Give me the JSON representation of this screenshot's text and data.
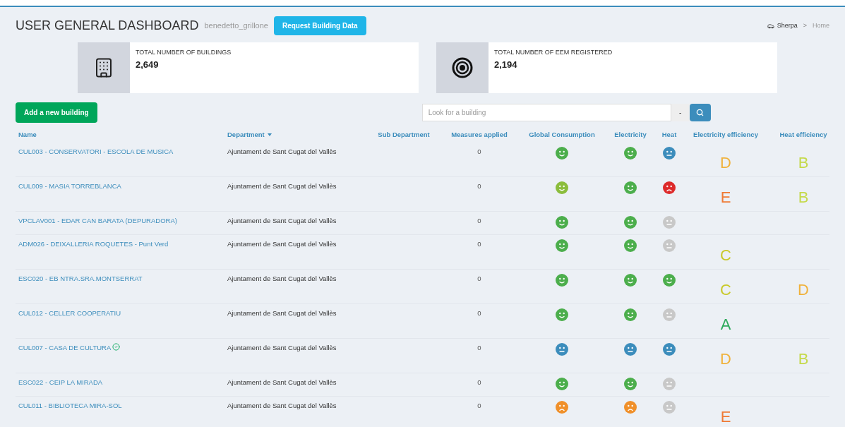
{
  "header": {
    "title": "USER GENERAL DASHBOARD",
    "username": "benedetto_grillone",
    "request_button": "Request Building Data"
  },
  "breadcrumb": {
    "items": [
      "Sherpa",
      "Home"
    ],
    "separator": ">"
  },
  "stats": [
    {
      "kind": "building",
      "label": "TOTAL NUMBER OF BUILDINGS",
      "value": "2,649"
    },
    {
      "kind": "target",
      "label": "TOTAL NUMBER OF EEM REGISTERED",
      "value": "2,194"
    }
  ],
  "add_button": "Add a new building",
  "search": {
    "placeholder": "Look for a building",
    "dropdown": "-"
  },
  "table": {
    "columns": [
      {
        "label": "Name",
        "sorted": false
      },
      {
        "label": "Department",
        "sorted": true
      },
      {
        "label": "Sub Department",
        "sorted": false
      },
      {
        "label": "Measures applied",
        "sorted": false
      },
      {
        "label": "Global Consumption",
        "sorted": false
      },
      {
        "label": "Electricity",
        "sorted": false
      },
      {
        "label": "Heat",
        "sorted": false
      },
      {
        "label": "Electricity efficiency",
        "sorted": false
      },
      {
        "label": "Heat efficiency",
        "sorted": false
      }
    ],
    "rows": [
      {
        "name": "CUL003 - CONSERVATORI - ESCOLA DE MUSICA",
        "verified": false,
        "department": "Ajuntament de Sant Cugat del Vallès",
        "measures": "0",
        "global": {
          "kind": "happy",
          "color": "#4cae4c"
        },
        "electricity": {
          "kind": "happy",
          "color": "#4cae4c"
        },
        "heat": {
          "kind": "neutral",
          "color": "#3c8dbc"
        },
        "elec_eff": {
          "grade": "D",
          "color": "#f0b23c"
        },
        "heat_eff": {
          "grade": "B",
          "color": "#c5d94a"
        }
      },
      {
        "name": "CUL009 - MASIA TORREBLANCA",
        "verified": false,
        "department": "Ajuntament de Sant Cugat del Vallès",
        "measures": "0",
        "global": {
          "kind": "happy",
          "color": "#8bbd3c"
        },
        "electricity": {
          "kind": "happy",
          "color": "#4cae4c"
        },
        "heat": {
          "kind": "sad",
          "color": "#dd2a2a"
        },
        "elec_eff": {
          "grade": "E",
          "color": "#ef7a35"
        },
        "heat_eff": {
          "grade": "B",
          "color": "#c5d94a"
        }
      },
      {
        "name": "VPCLAV001 - EDAR CAN BARATA (DEPURADORA)",
        "verified": false,
        "department": "Ajuntament de Sant Cugat del Vallès",
        "measures": "0",
        "global": {
          "kind": "happy",
          "color": "#4cae4c"
        },
        "electricity": {
          "kind": "happy",
          "color": "#4cae4c"
        },
        "heat": {
          "kind": "neutral",
          "color": "#c8c8c8"
        }
      },
      {
        "name": "ADM026 - DEIXALLERIA ROQUETES - Punt Verd",
        "verified": false,
        "department": "Ajuntament de Sant Cugat del Vallès",
        "measures": "0",
        "global": {
          "kind": "happy",
          "color": "#4cae4c"
        },
        "electricity": {
          "kind": "happy",
          "color": "#4cae4c"
        },
        "heat": {
          "kind": "neutral",
          "color": "#c8c8c8"
        },
        "elec_eff": {
          "grade": "C",
          "color": "#c9c92a"
        }
      },
      {
        "name": "ESC020 - EB NTRA.SRA.MONTSERRAT",
        "verified": false,
        "department": "Ajuntament de Sant Cugat del Vallès",
        "measures": "0",
        "global": {
          "kind": "happy",
          "color": "#4cae4c"
        },
        "electricity": {
          "kind": "happy",
          "color": "#4cae4c"
        },
        "heat": {
          "kind": "happy",
          "color": "#4cae4c"
        },
        "elec_eff": {
          "grade": "C",
          "color": "#c9c92a"
        },
        "heat_eff": {
          "grade": "D",
          "color": "#f0b23c"
        }
      },
      {
        "name": "CUL012 - CELLER COOPERATIU",
        "verified": false,
        "department": "Ajuntament de Sant Cugat del Vallès",
        "measures": "0",
        "global": {
          "kind": "happy",
          "color": "#4cae4c"
        },
        "electricity": {
          "kind": "happy",
          "color": "#4cae4c"
        },
        "heat": {
          "kind": "neutral",
          "color": "#c8c8c8"
        },
        "elec_eff": {
          "grade": "A",
          "color": "#2eaa5c"
        }
      },
      {
        "name": "CUL007 - CASA DE CULTURA",
        "verified": true,
        "department": "Ajuntament de Sant Cugat del Vallès",
        "measures": "0",
        "global": {
          "kind": "neutral",
          "color": "#3c8dbc"
        },
        "electricity": {
          "kind": "neutral",
          "color": "#3c8dbc"
        },
        "heat": {
          "kind": "neutral",
          "color": "#3c8dbc"
        },
        "elec_eff": {
          "grade": "D",
          "color": "#f0b23c"
        },
        "heat_eff": {
          "grade": "B",
          "color": "#c5d94a"
        }
      },
      {
        "name": "ESC022 - CEIP LA MIRADA",
        "verified": false,
        "department": "Ajuntament de Sant Cugat del Vallès",
        "measures": "0",
        "global": {
          "kind": "happy",
          "color": "#4cae4c"
        },
        "electricity": {
          "kind": "happy",
          "color": "#4cae4c"
        },
        "heat": {
          "kind": "neutral",
          "color": "#c8c8c8"
        }
      },
      {
        "name": "CUL011 - BIBLIOTECA MIRA-SOL",
        "verified": false,
        "department": "Ajuntament de Sant Cugat del Vallès",
        "measures": "0",
        "global": {
          "kind": "sad",
          "color": "#f0902a"
        },
        "electricity": {
          "kind": "sad",
          "color": "#f0902a"
        },
        "heat": {
          "kind": "neutral",
          "color": "#c8c8c8"
        },
        "elec_eff": {
          "grade": "E",
          "color": "#ef7a35"
        }
      }
    ]
  }
}
